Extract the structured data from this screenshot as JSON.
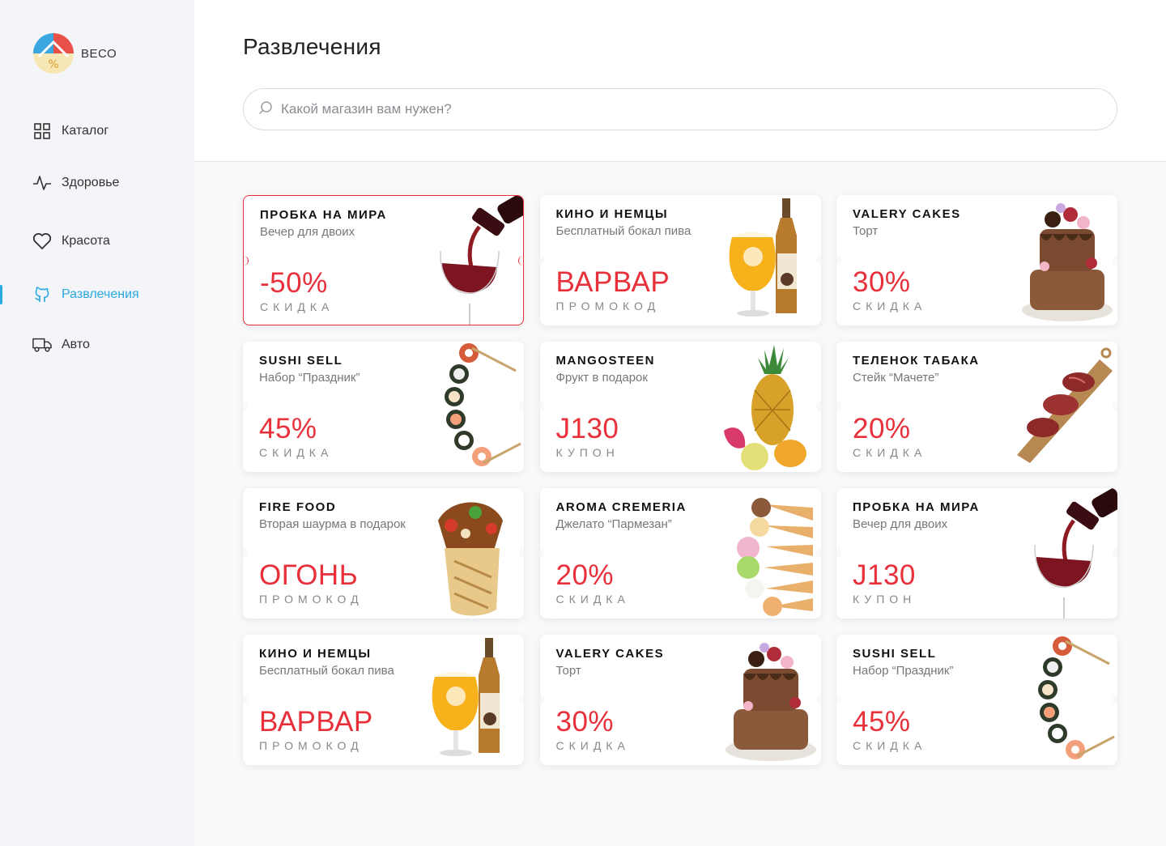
{
  "app": {
    "name": "ВЕСО"
  },
  "sidebar": {
    "items": [
      {
        "label": "Каталог",
        "icon": "grid-icon",
        "active": false
      },
      {
        "label": "Здоровье",
        "icon": "pulse-icon",
        "active": false
      },
      {
        "label": "Красота",
        "icon": "heart-icon",
        "active": false
      },
      {
        "label": "Развлечения",
        "icon": "github-icon",
        "active": true
      },
      {
        "label": "Авто",
        "icon": "truck-icon",
        "active": false
      }
    ]
  },
  "header": {
    "title": "Развлечения",
    "search_placeholder": "Какой магазин вам нужен?"
  },
  "colors": {
    "accent": "#2aa8e0",
    "promo": "#e8303a"
  },
  "cards": [
    {
      "name": "ПРОБКА НА МИРА",
      "desc": "Вечер для двоих",
      "value": "-50%",
      "type": "СКИДКА",
      "art": "wine-icon",
      "selected": true
    },
    {
      "name": "КИНО И НЕМЦЫ",
      "desc": "Бесплатный бокал пива",
      "value": "ВАРВАР",
      "type": "ПРОМОКОД",
      "art": "beer-icon",
      "selected": false
    },
    {
      "name": "VALERY CAKES",
      "desc": "Торт",
      "value": "30%",
      "type": "СКИДКА",
      "art": "cake-icon",
      "selected": false
    },
    {
      "name": "SUSHI SELL",
      "desc": "Набор “Праздник”",
      "value": "45%",
      "type": "СКИДКА",
      "art": "sushi-icon",
      "selected": false
    },
    {
      "name": "MANGOSTEEN",
      "desc": "Фрукт в подарок",
      "value": "J130",
      "type": "КУПОН",
      "art": "fruit-icon",
      "selected": false
    },
    {
      "name": "ТЕЛЕНОК ТАБАКА",
      "desc": "Стейк “Мачете”",
      "value": "20%",
      "type": "СКИДКА",
      "art": "steak-icon",
      "selected": false
    },
    {
      "name": "FIRE FOOD",
      "desc": "Вторая шаурма в подарок",
      "value": "ОГОНЬ",
      "type": "ПРОМОКОД",
      "art": "shawarma-icon",
      "selected": false
    },
    {
      "name": "AROMA CREMERIA",
      "desc": "Джелато “Пармезан”",
      "value": "20%",
      "type": "СКИДКА",
      "art": "icecream-icon",
      "selected": false
    },
    {
      "name": "ПРОБКА НА МИРА",
      "desc": "Вечер для двоих",
      "value": "J130",
      "type": "КУПОН",
      "art": "wine-icon",
      "selected": false
    },
    {
      "name": "КИНО И НЕМЦЫ",
      "desc": "Бесплатный бокал пива",
      "value": "ВАРВАР",
      "type": "ПРОМОКОД",
      "art": "beer-icon",
      "selected": false
    },
    {
      "name": "VALERY CAKES",
      "desc": "Торт",
      "value": "30%",
      "type": "СКИДКА",
      "art": "cake-icon",
      "selected": false
    },
    {
      "name": "SUSHI SELL",
      "desc": "Набор “Праздник”",
      "value": "45%",
      "type": "СКИДКА",
      "art": "sushi-icon",
      "selected": false
    }
  ]
}
